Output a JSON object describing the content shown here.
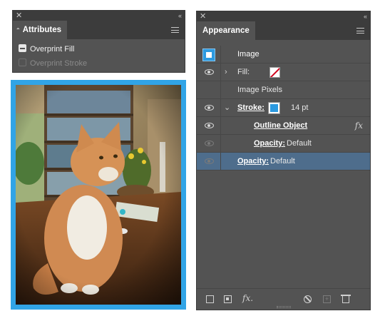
{
  "attributes_panel": {
    "tab_label": "Attributes",
    "overprint_fill": {
      "label": "Overprint Fill",
      "checked": "mixed"
    },
    "overprint_stroke": {
      "label": "Overprint Stroke",
      "checked": false,
      "disabled": true
    }
  },
  "appearance_panel": {
    "tab_label": "Appearance",
    "object_type": "Image",
    "rows": {
      "fill": {
        "label": "Fill:"
      },
      "image_pixels": {
        "label": "Image Pixels"
      },
      "stroke": {
        "label": "Stroke:",
        "weight": "14 pt",
        "color": "#2c9ae0"
      },
      "outline_object": {
        "label": "Outline Object",
        "fx": "fx"
      },
      "stroke_opacity": {
        "label": "Opacity:",
        "value": "Default"
      },
      "object_opacity": {
        "label": "Opacity:",
        "value": "Default"
      }
    },
    "footer": {
      "new_effect": "fx."
    }
  },
  "image": {
    "subject": "orange and white cat sitting on a wooden table",
    "stroke_color": "#31a4e6"
  },
  "colors": {
    "panel_bg": "#535353",
    "panel_header": "#3c3c3c",
    "selection": "#4e6d8c",
    "accent_blue": "#2c9ae0"
  }
}
